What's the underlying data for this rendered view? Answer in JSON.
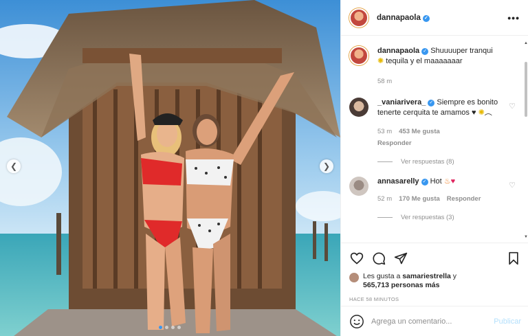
{
  "post": {
    "author": "dannapaola",
    "more_label": "•••"
  },
  "caption": {
    "username": "dannapaola",
    "text_before": "Shuuuuper tranqui",
    "text_after": "tequila y el maaaaaaar",
    "time": "58 m"
  },
  "comments": [
    {
      "username": "_vaniarivera_",
      "text": "Siempre es bonito tenerte cerquita te amamos ♥",
      "time": "53 m",
      "likes": "453 Me gusta",
      "reply_label": "Responder",
      "replies_label": "Ver respuestas (8)",
      "verified": true
    },
    {
      "username": "annasarelly",
      "text": "Hot",
      "time": "52 m",
      "likes": "170 Me gusta",
      "reply_label": "Responder",
      "replies_label": "Ver respuestas (3)",
      "verified": true
    }
  ],
  "likes": {
    "prefix": "Les gusta a",
    "user": "samariestrella",
    "connector": "y",
    "count": "565,713 personas más"
  },
  "posted_ago": "HACE 58 MINUTOS",
  "add_comment": {
    "placeholder": "Agrega un comentario...",
    "publish_label": "Publicar"
  },
  "carousel": {
    "slide_count": 4,
    "active_index": 0
  },
  "colors": {
    "accent": "#3897f0",
    "publish_disabled": "#b2dffc",
    "muted": "#8e8e8e"
  },
  "icons": {
    "like": "heart-icon",
    "comment": "comment-icon",
    "share": "share-icon",
    "save": "bookmark-icon",
    "emoji": "smile-icon",
    "verified": "verified-badge-icon"
  }
}
